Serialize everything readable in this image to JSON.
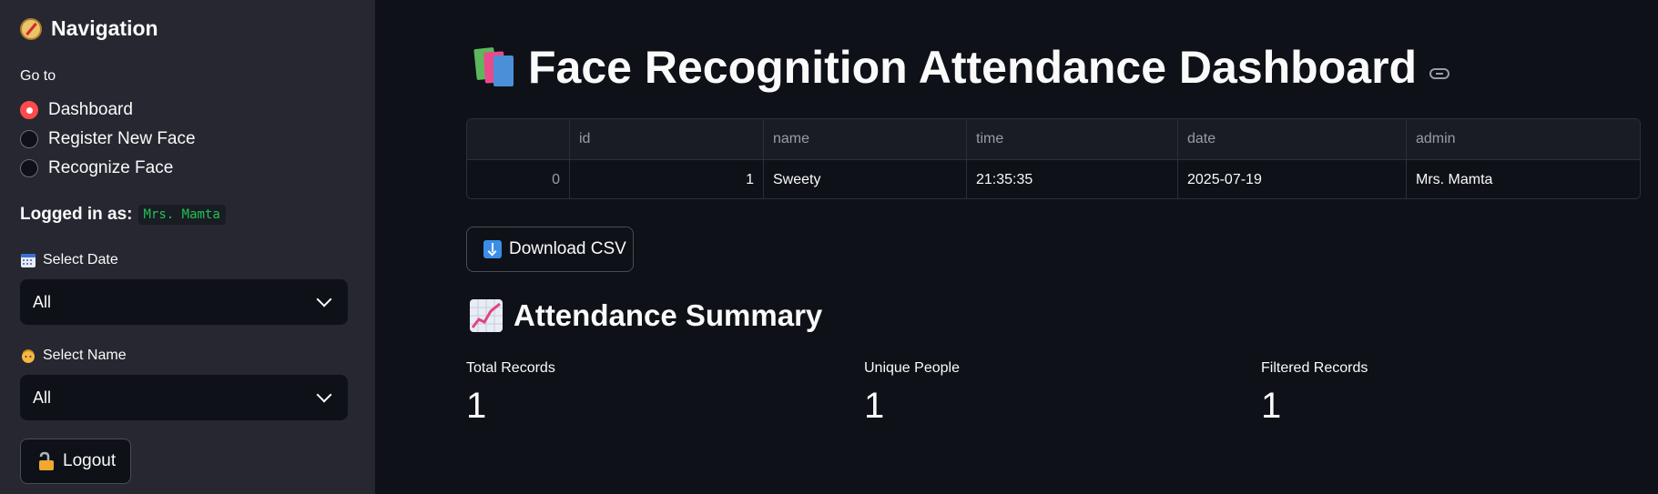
{
  "sidebar": {
    "title": "Navigation",
    "title_icon": "compass-icon",
    "goto_label": "Go to",
    "options": [
      {
        "label": "Dashboard",
        "selected": true
      },
      {
        "label": "Register New Face",
        "selected": false
      },
      {
        "label": "Recognize Face",
        "selected": false
      }
    ],
    "logged_in_label": "Logged in as:",
    "logged_in_user": "Mrs. Mamta",
    "date_select": {
      "label": "Select Date",
      "icon": "calendar-icon",
      "value": "All"
    },
    "name_select": {
      "label": "Select Name",
      "icon": "person-icon",
      "value": "All"
    },
    "logout_label": "Logout",
    "logout_icon": "unlocked-padlock-icon"
  },
  "main": {
    "title": "Face Recognition Attendance Dashboard",
    "title_icon": "books-icon",
    "table": {
      "columns": [
        "",
        "id",
        "name",
        "time",
        "date",
        "admin"
      ],
      "rows": [
        [
          "0",
          "1",
          "Sweety",
          "21:35:35",
          "2025-07-19",
          "Mrs. Mamta"
        ]
      ]
    },
    "download_label": "Download CSV",
    "download_icon": "download-arrow-icon",
    "summary_title": "Attendance Summary",
    "summary_icon": "chart-increasing-icon",
    "metrics": [
      {
        "label": "Total Records",
        "value": "1"
      },
      {
        "label": "Unique People",
        "value": "1"
      },
      {
        "label": "Filtered Records",
        "value": "1"
      }
    ]
  },
  "colors": {
    "sidebar_bg": "#262730",
    "main_bg": "#0e1117",
    "accent": "#ff4b4b",
    "code_text": "#21c354"
  }
}
